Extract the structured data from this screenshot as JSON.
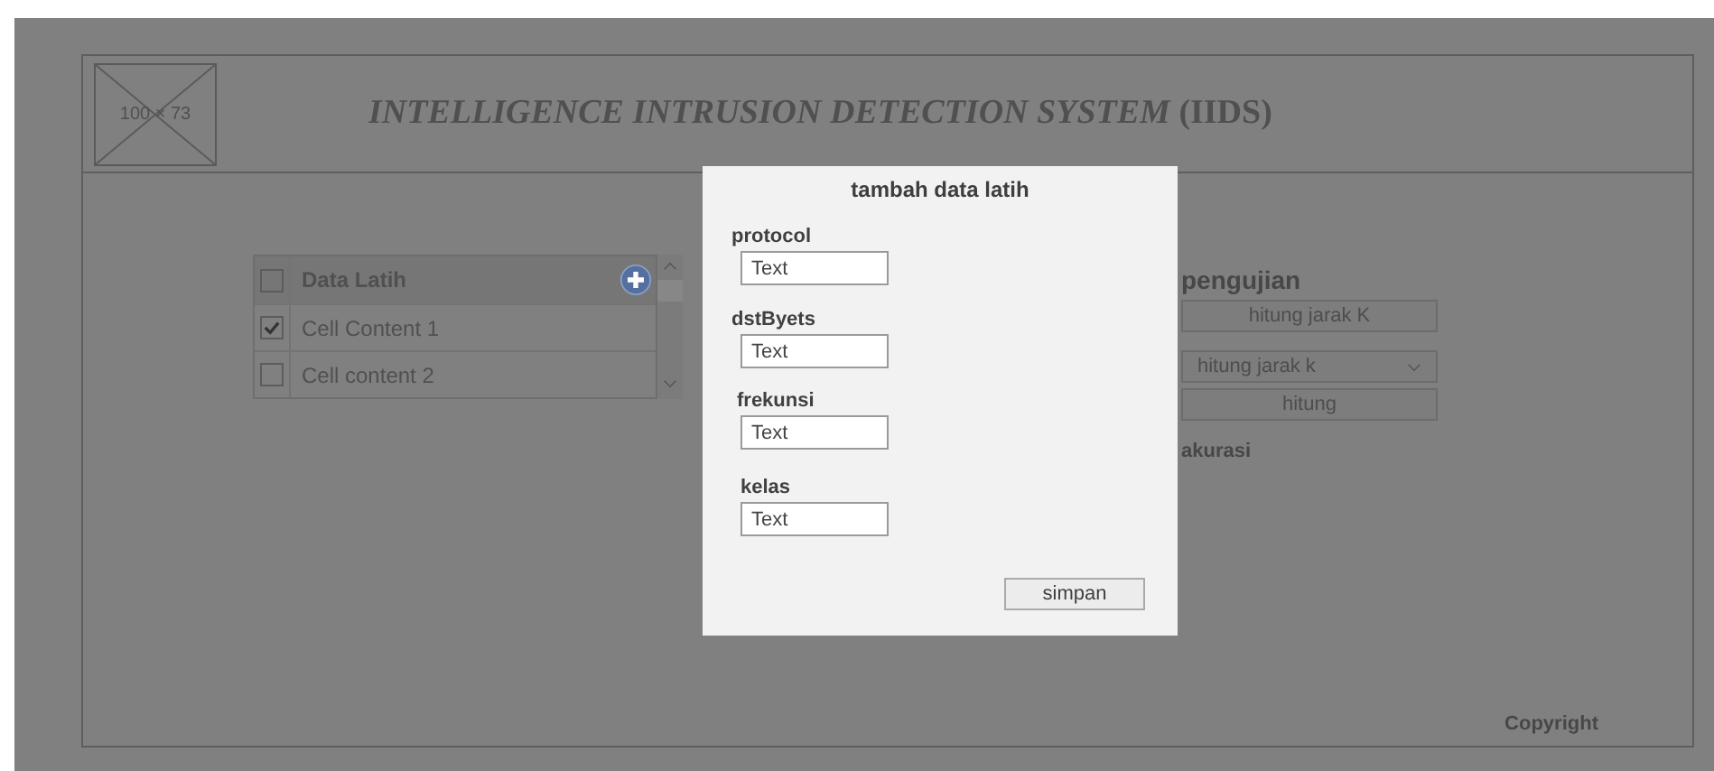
{
  "header": {
    "logo_placeholder": "100 × 73",
    "title": "INTELLIGENCE INTRUSION DETECTION SYSTEM",
    "title_suffix": "(IIDS)"
  },
  "table": {
    "header": {
      "label": "Data Latih",
      "checked": false
    },
    "rows": [
      {
        "label": "Cell Content 1",
        "checked": true
      },
      {
        "label": "Cell content 2",
        "checked": false
      }
    ]
  },
  "testing": {
    "heading": "pengujian",
    "controls": [
      {
        "kind": "button",
        "label": "hitung jarak K"
      },
      {
        "kind": "dropdown",
        "label": "hitung jarak k"
      },
      {
        "kind": "button",
        "label": "hitung"
      }
    ],
    "result_label": "akurasi"
  },
  "footer": {
    "copyright": "Copyright"
  },
  "dialog": {
    "title": "tambah data latih",
    "fields": [
      {
        "label": "protocol",
        "value": "Text"
      },
      {
        "label": "dstByets",
        "value": "Text"
      },
      {
        "label": "frekunsi",
        "value": "Text"
      },
      {
        "label": "kelas",
        "value": "Text"
      }
    ],
    "save_button": "simpan"
  }
}
